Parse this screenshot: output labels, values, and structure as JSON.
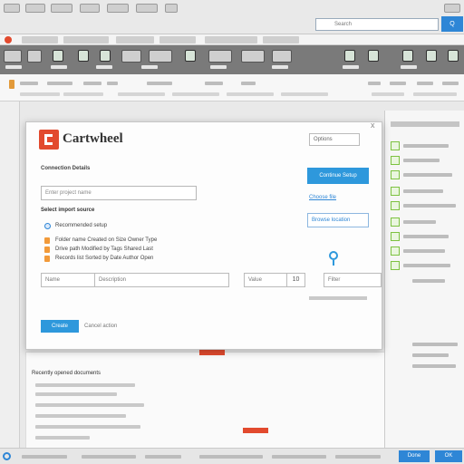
{
  "search": {
    "placeholder": "Search",
    "button_label": "Q"
  },
  "dialog": {
    "title": "Cartwheel",
    "top_right_button": "Options",
    "close_label": "x",
    "section_label": "Connection Details",
    "main_input": "Enter project name",
    "sub_heading": "Select import source",
    "radio_label": "Recommended setup",
    "list_items": [
      "Folder name  Created on  Size  Owner  Type",
      "Drive path  Modified by  Tags  Shared  Last",
      "Records list  Sorted by  Date  Author  Open"
    ],
    "primary_action": "Continue Setup",
    "select_link": "Choose file",
    "select_box": "Browse location",
    "row_inputs": {
      "a": "Name",
      "b": "Description",
      "c": "Value",
      "d": "10",
      "e": "Filter"
    },
    "ok_button": "Create",
    "cancel_link": "Cancel action"
  },
  "background_doc": {
    "heading": "Recently opened documents"
  },
  "status": {
    "button1": "Done",
    "button2": "OK"
  },
  "colors": {
    "accent": "#2e98dc",
    "brand": "#e24a2e",
    "success": "#7dc241"
  }
}
